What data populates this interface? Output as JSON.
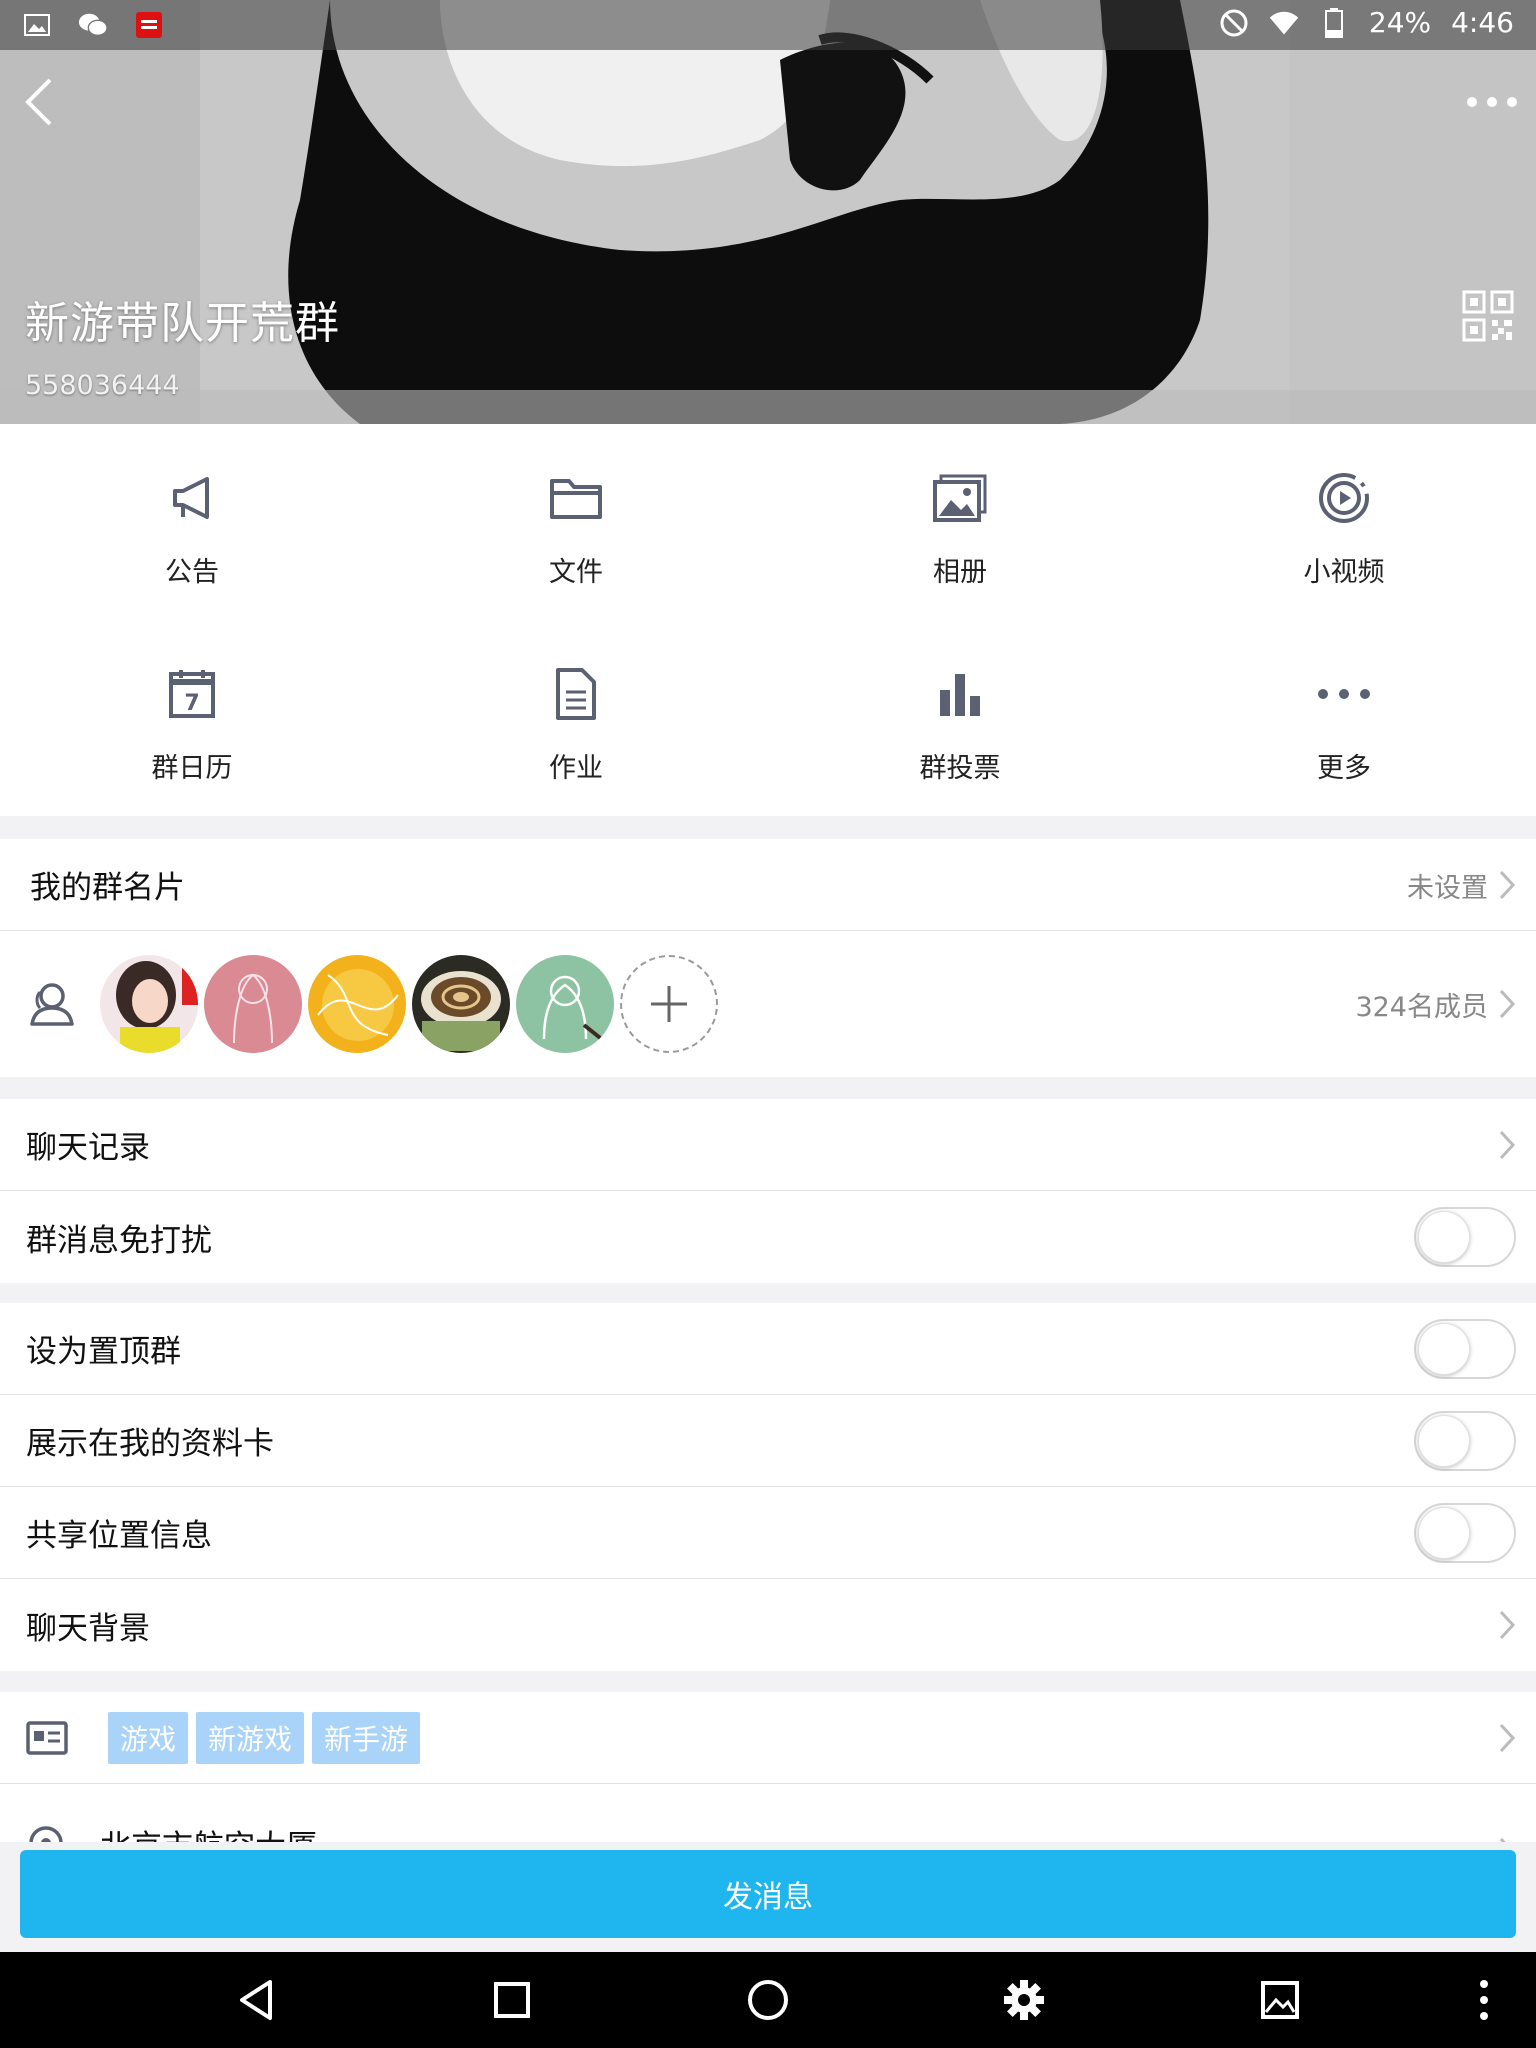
{
  "status_bar": {
    "battery": "24%",
    "time": "4:46"
  },
  "group": {
    "name": "新游带队开荒群",
    "id": "558036444"
  },
  "grid": [
    {
      "label": "公告",
      "icon": "megaphone-icon"
    },
    {
      "label": "文件",
      "icon": "folder-icon"
    },
    {
      "label": "相册",
      "icon": "album-icon"
    },
    {
      "label": "小视频",
      "icon": "video-icon"
    },
    {
      "label": "群日历",
      "icon": "calendar-icon"
    },
    {
      "label": "作业",
      "icon": "document-icon"
    },
    {
      "label": "群投票",
      "icon": "bar-chart-icon"
    },
    {
      "label": "更多",
      "icon": "more-icon"
    }
  ],
  "calendar_day": "7",
  "my_card": {
    "label": "我的群名片",
    "value": "未设置"
  },
  "members": {
    "count_label": "324名成员"
  },
  "settings_a": [
    {
      "label": "聊天记录",
      "type": "link"
    },
    {
      "label": "群消息免打扰",
      "type": "toggle",
      "on": false
    }
  ],
  "settings_b": [
    {
      "label": "设为置顶群",
      "type": "toggle",
      "on": false
    },
    {
      "label": "展示在我的资料卡",
      "type": "toggle",
      "on": false
    },
    {
      "label": "共享位置信息",
      "type": "toggle",
      "on": false
    },
    {
      "label": "聊天背景",
      "type": "link"
    }
  ],
  "tags": [
    "游戏",
    "新游戏",
    "新手游"
  ],
  "location": "北京市航空大厦",
  "send_button": "发消息",
  "colors": {
    "accent": "#1fb6f0",
    "tag": "#a9d3f8"
  }
}
